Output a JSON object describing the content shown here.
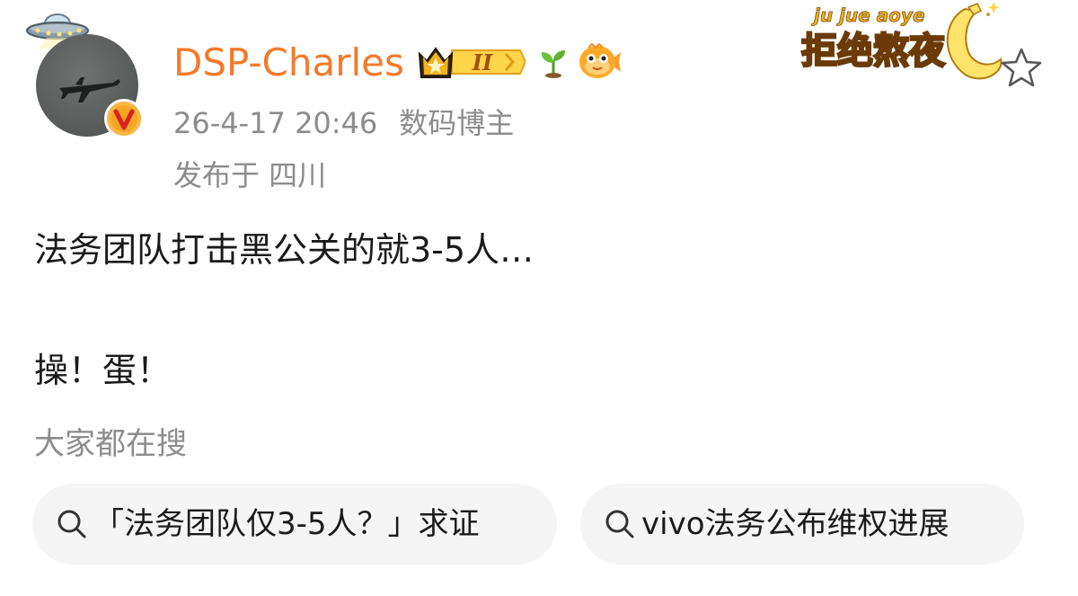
{
  "author": {
    "username": "DSP-Charles",
    "vip_level": "II",
    "verified_badge": "V"
  },
  "post": {
    "timestamp": "26-4-17 20:46",
    "author_role": "数码博主",
    "location": "发布于 四川",
    "lines": [
      "法务团队打击黑公关的就3-5人…",
      "操！蛋！"
    ]
  },
  "decoration": {
    "sticker_pinyin": "ju jue aoye",
    "sticker_text": "拒绝熬夜"
  },
  "search": {
    "heading": "大家都在搜",
    "chips": [
      "「法务团队仅3-5人？」求证",
      "vivo法务公布维权进展"
    ]
  },
  "colors": {
    "username": "#f37a2a",
    "meta": "#8c8c8c",
    "body_text": "#1a1a1a",
    "chip_bg": "#f5f5f5",
    "verified": "#f5a623"
  },
  "icons": [
    "ufo-icon",
    "crown-vip-icon",
    "sprout-icon",
    "fish-icon",
    "verified-badge-icon",
    "star-icon",
    "search-icon"
  ]
}
